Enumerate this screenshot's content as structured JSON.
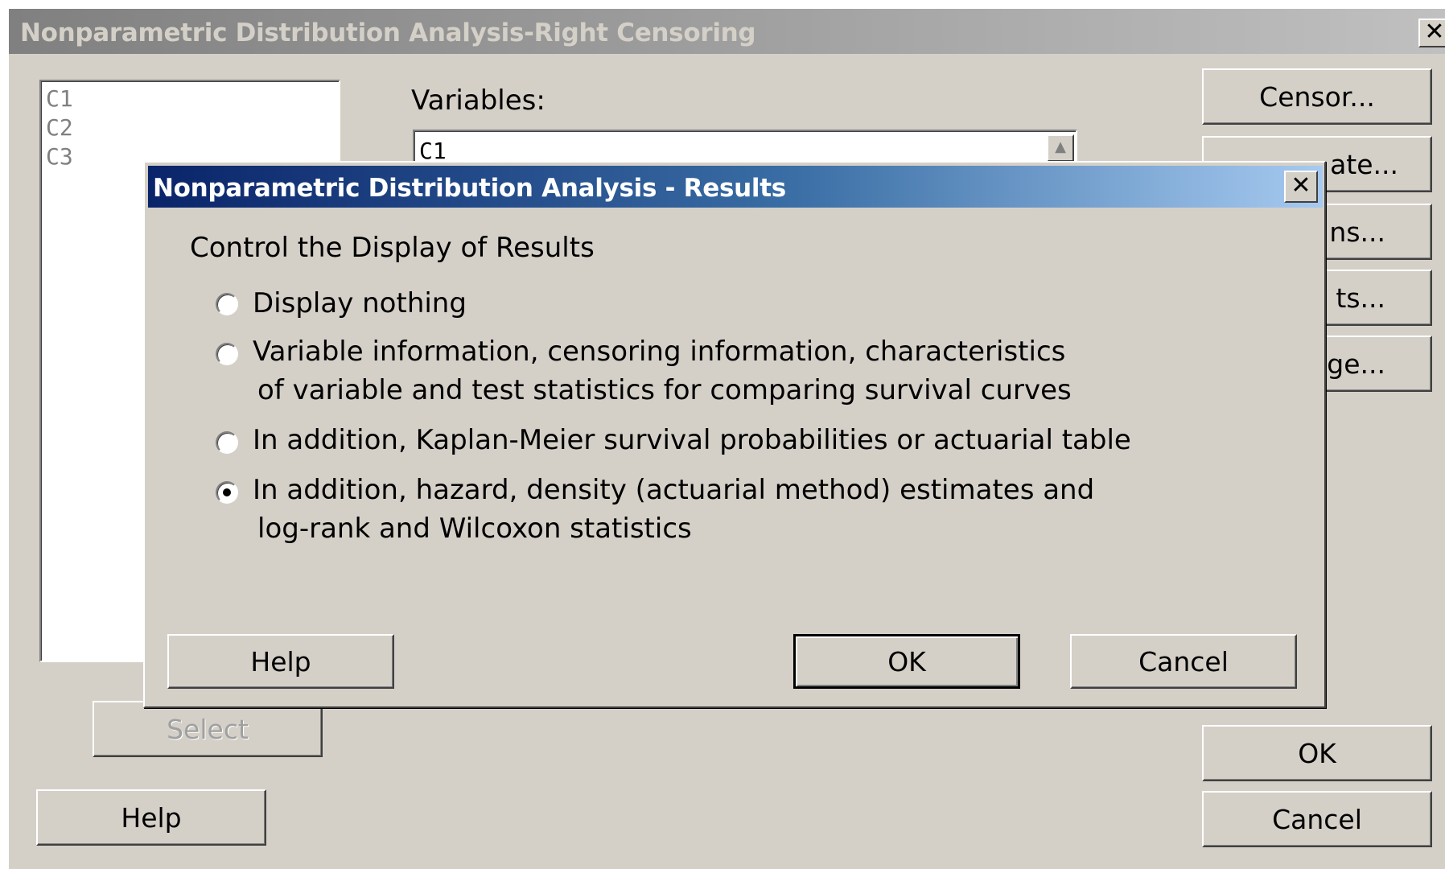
{
  "background_dialog": {
    "title": "Nonparametric Distribution Analysis-Right Censoring",
    "close_label": "✕",
    "columns": [
      "C1",
      "C2",
      "C3"
    ],
    "variables_label": "Variables:",
    "variables_value": "C1",
    "right_buttons": [
      "Censor...",
      "ate...",
      "ns...",
      "ts...",
      "ge..."
    ],
    "select_label": "Select",
    "help_label": "Help",
    "ok_label": "OK",
    "cancel_label": "Cancel"
  },
  "results_dialog": {
    "title": "Nonparametric Distribution Analysis - Results",
    "close_label": "✕",
    "group_label": "Control the Display of Results",
    "options": [
      {
        "line1": "Display nothing",
        "line2": "",
        "selected": false
      },
      {
        "line1": "Variable information, censoring information, characteristics",
        "line2": "of variable and test statistics for comparing survival curves",
        "selected": false
      },
      {
        "line1": "In addition, Kaplan-Meier survival probabilities or actuarial table",
        "line2": "",
        "selected": false
      },
      {
        "line1": "In addition, hazard, density (actuarial method) estimates and",
        "line2": "log-rank and Wilcoxon statistics",
        "selected": true
      }
    ],
    "help_label": "Help",
    "ok_label": "OK",
    "cancel_label": "Cancel"
  }
}
